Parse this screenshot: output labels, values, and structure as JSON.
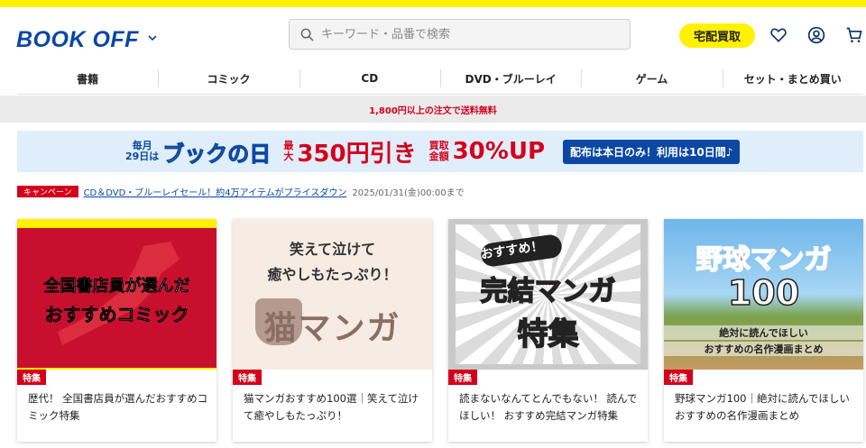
{
  "header": {
    "logo_text": "BOOK OFF",
    "search_placeholder": "キーワード・品番で検索",
    "buy_button": "宅配買取"
  },
  "nav": [
    "書籍",
    "コミック",
    "CD",
    "DVD・ブルーレイ",
    "ゲーム",
    "セット・まとめ買い"
  ],
  "shipping_notice": "1,800円以上の注文で送料無料",
  "banner": {
    "line1a": "毎月",
    "line1b": "29日は",
    "main": "ブックの日",
    "max_a": "最",
    "max_b": "大",
    "discount": "350円引き",
    "buy_a": "買取",
    "buy_b": "金額",
    "buy_up": "30%UP",
    "note": "配布は本日のみ！利用は10日間♪"
  },
  "campaign": {
    "badge": "キャンペーン",
    "link": "CD＆DVD・ブルーレイセール！約4万アイテムがプライスダウン",
    "date": "2025/01/31(金)00:00まで"
  },
  "cards": [
    {
      "tag": "特集",
      "title": "歴代！ 全国書店員が選んだおすすめコミック特集",
      "img_line1": "全国書店員が選んだ",
      "img_line2": "おすすめコミック"
    },
    {
      "tag": "特集",
      "title": "猫マンガおすすめ100選｜笑えて泣けて癒やしもたっぷり！",
      "img_line1": "笑えて泣けて",
      "img_line2": "癒やしもたっぷり！",
      "img_line3": "猫マンガ"
    },
    {
      "tag": "特集",
      "title": "読まないなんてとんでもない！ 読んでほしい！ おすすめ完結マンガ特集",
      "img_line1": "おすすめ！",
      "img_line2": "完結マンガ",
      "img_line3": "特集"
    },
    {
      "tag": "特集",
      "title": "野球マンガ100｜絶対に読んでほしいおすすめの名作漫画まとめ",
      "img_line1": "野球マンガ",
      "img_line2": "100",
      "img_line3": "絶対に読んでほしい",
      "img_line4": "おすすめの名作漫画まとめ"
    }
  ],
  "colors": {
    "brand_blue": "#0b47a3",
    "accent_yellow": "#fff100",
    "sale_red": "#d4001c"
  }
}
